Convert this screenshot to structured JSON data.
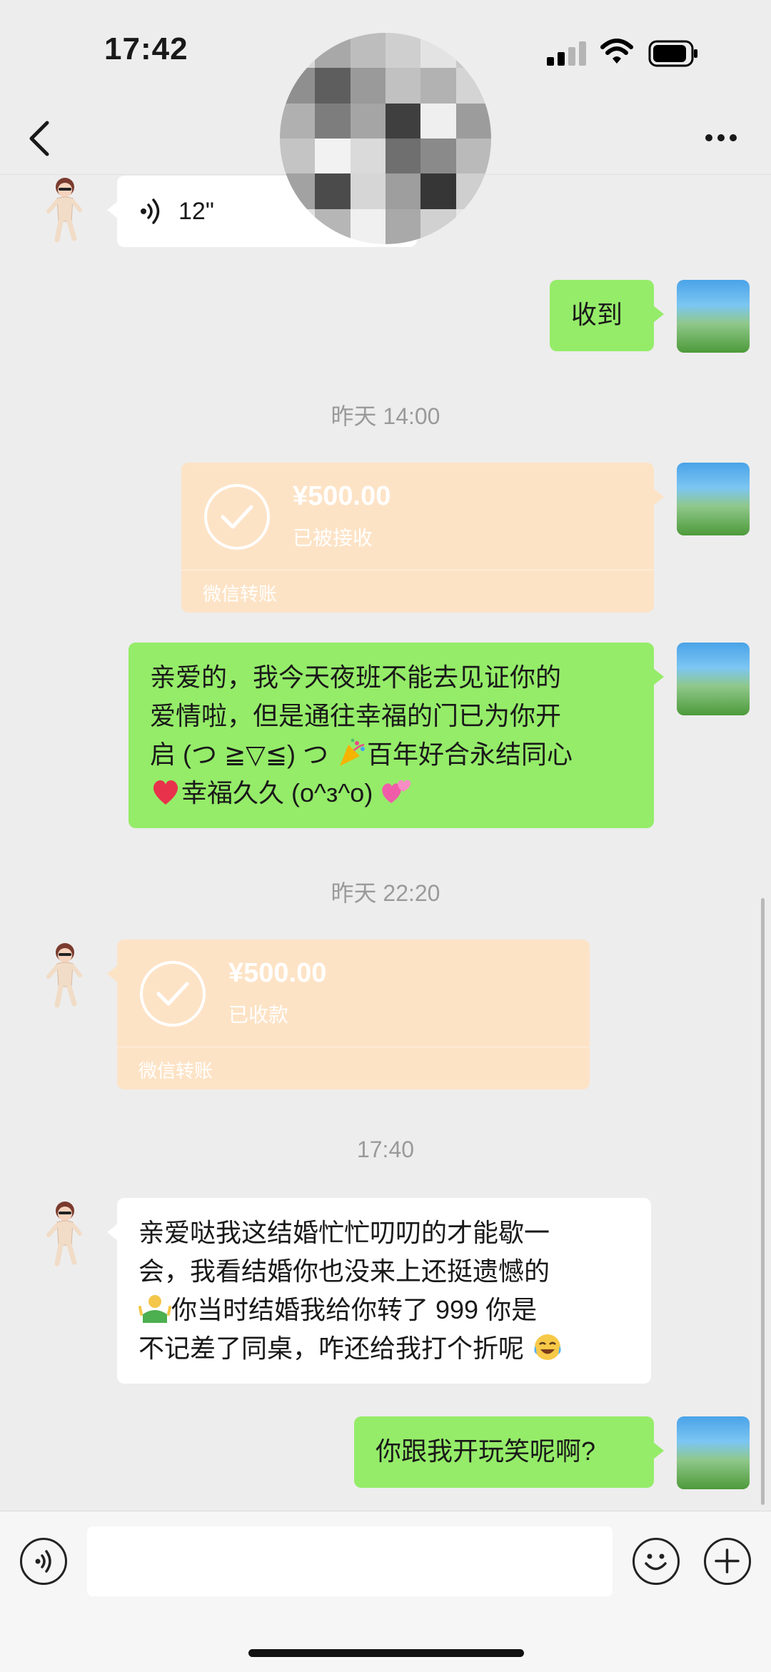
{
  "status_bar": {
    "time": "17:42"
  },
  "nav": {
    "back_icon": "chevron-left-icon",
    "more_icon": "more-dots-icon"
  },
  "messages": {
    "voice": {
      "duration": "12\""
    },
    "received_ok": {
      "text": "收到"
    },
    "time1": "昨天 14:00",
    "transfer_sent": {
      "amount": "¥500.00",
      "status": "已被接收",
      "footer": "微信转账"
    },
    "blessing": {
      "line1": "亲爱的，我今天夜班不能去见证你的",
      "line2": "爱情啦，但是通往幸福的门已为你开",
      "line3a": "启 (つ ≧▽≦) つ",
      "line3b": "百年好合永结同心",
      "line4": "幸福久久 (o^з^o)"
    },
    "time2": "昨天 22:20",
    "transfer_received": {
      "amount": "¥500.00",
      "status": "已收款",
      "footer": "微信转账"
    },
    "time3": "17:40",
    "complaint": {
      "line1": "亲爱哒我这结婚忙忙叨叨的才能歇一",
      "line2": "会，我看结婚你也没来上还挺遗憾的",
      "line3": "你当时结婚我给你转了 999 你是",
      "line4": "不记差了同桌，咋还给我打个折呢"
    },
    "reply": {
      "text": "你跟我开玩笑呢啊?"
    }
  },
  "input_bar": {
    "voice_icon": "voice-icon",
    "emoji_icon": "emoji-icon",
    "plus_icon": "plus-icon"
  },
  "colors": {
    "bg": "#EDEDED",
    "green_bubble": "#95EC69",
    "white_bubble": "#FFFFFF",
    "transfer_card": "#FDE3C6"
  }
}
